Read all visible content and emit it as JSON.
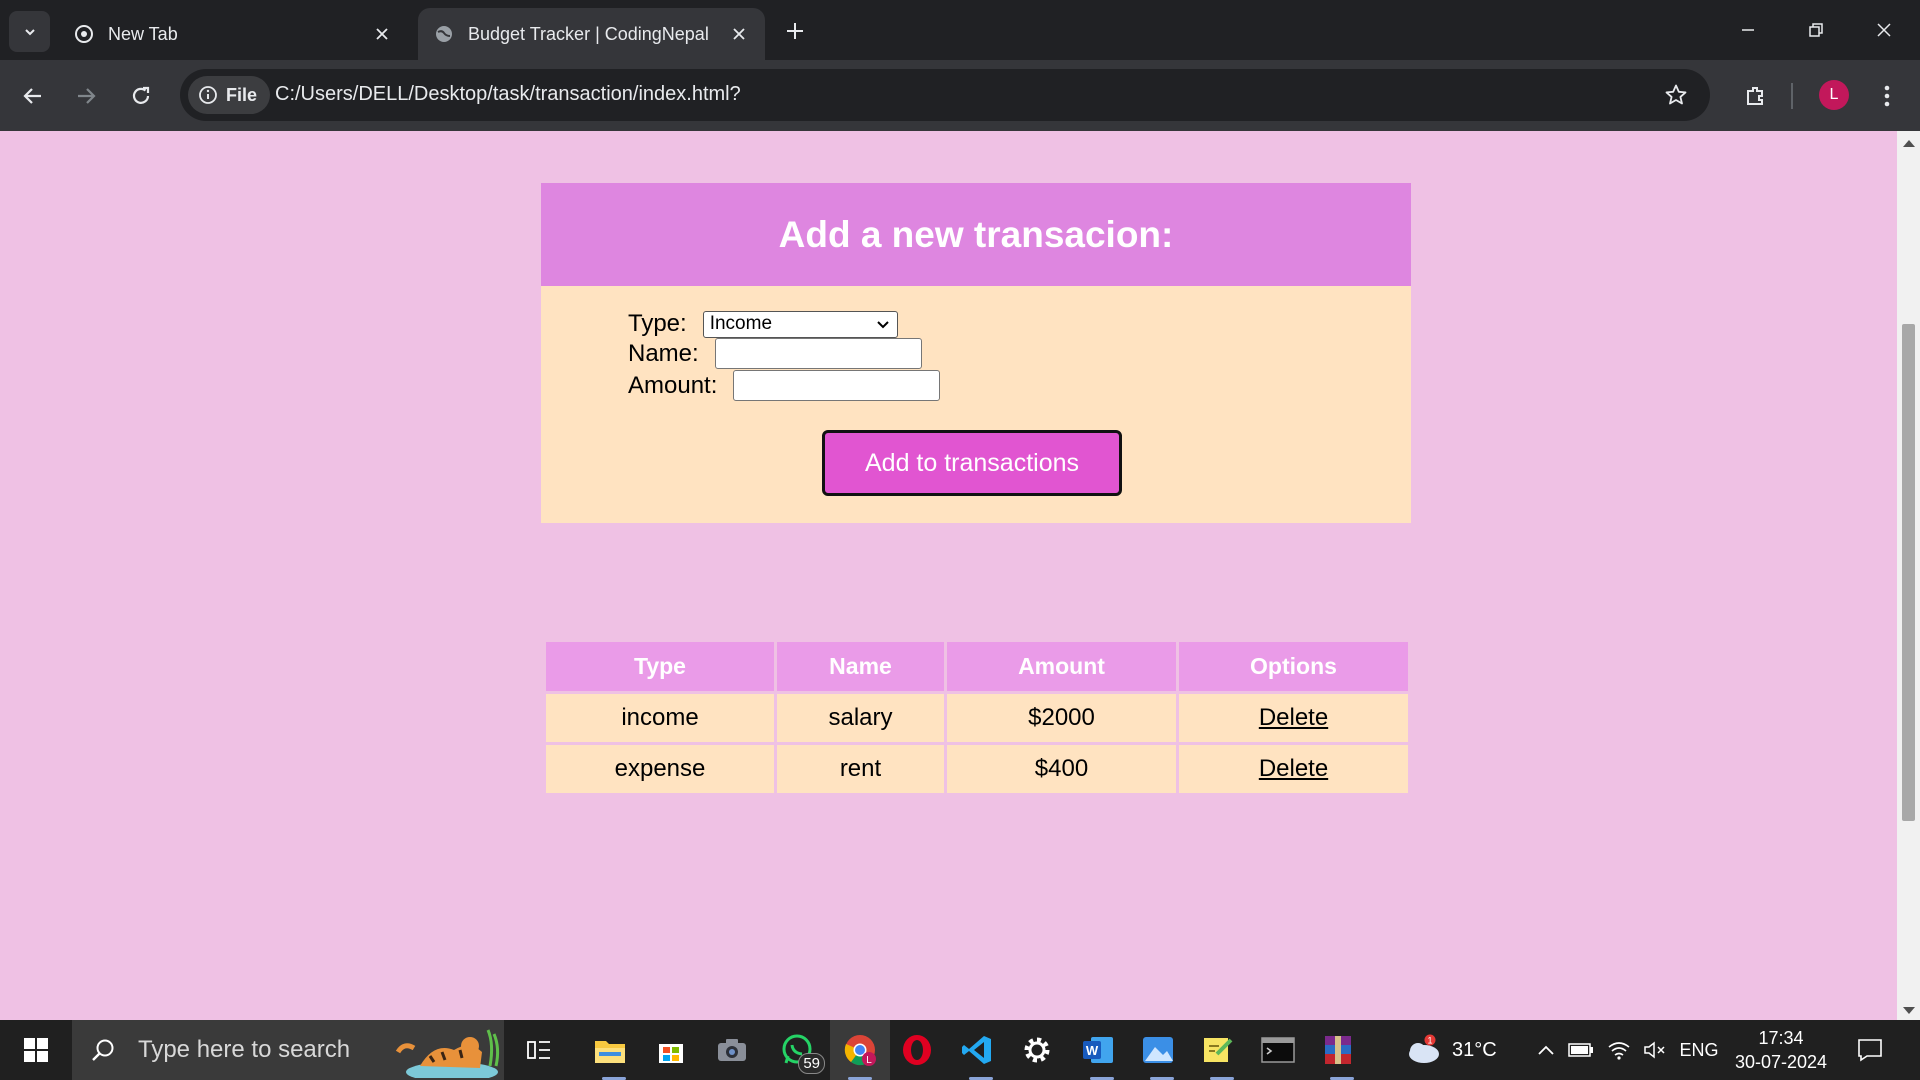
{
  "browser": {
    "tabs": [
      {
        "title": "New Tab",
        "active": false
      },
      {
        "title": "Budget Tracker | CodingNepal",
        "active": true
      }
    ],
    "chip_label": "File",
    "url": "C:/Users/DELL/Desktop/task/transaction/index.html?",
    "profile_initial": "L"
  },
  "form": {
    "heading": "Add a new transacion:",
    "type_label": "Type:",
    "type_selected": "Income",
    "name_label": "Name:",
    "name_value": "",
    "amount_label": "Amount:",
    "amount_value": "",
    "submit_label": "Add to transactions"
  },
  "table": {
    "headers": [
      "Type",
      "Name",
      "Amount",
      "Options"
    ],
    "rows": [
      {
        "type": "income",
        "name": "salary",
        "amount": "$2000",
        "option": "Delete"
      },
      {
        "type": "expense",
        "name": "rent",
        "amount": "$400",
        "option": "Delete"
      }
    ]
  },
  "taskbar": {
    "search_placeholder": "Type here to search",
    "whatsapp_badge": "59",
    "weather_badge": "1",
    "temperature": "31°C",
    "language": "ENG",
    "time": "17:34",
    "date": "30-07-2024",
    "apps": [
      "task-view-icon",
      "file-explorer-icon",
      "microsoft-store-icon",
      "camera-icon",
      "whatsapp-icon",
      "chrome-icon",
      "opera-icon",
      "vscode-icon",
      "settings-icon",
      "word-icon",
      "photos-icon",
      "sticky-notes-icon",
      "terminal-icon",
      "winrar-icon"
    ]
  },
  "colors": {
    "page_bg": "#efc1e4",
    "form_header": "#de86e0",
    "card_bg": "#ffe3c1",
    "table_header": "#ea9be8",
    "button": "#e155d1"
  }
}
